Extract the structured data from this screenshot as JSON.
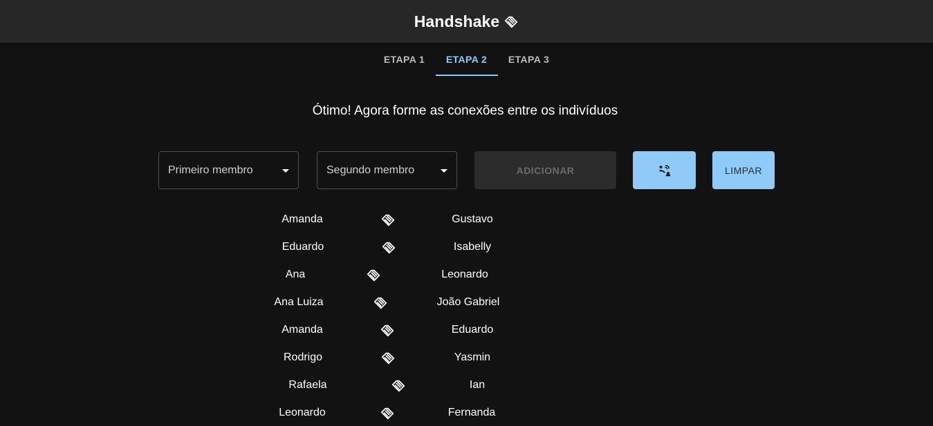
{
  "app": {
    "title": "Handshake",
    "logo_icon": "handshake-icon"
  },
  "tabs": [
    {
      "label": "ETAPA 1",
      "active": false
    },
    {
      "label": "ETAPA 2",
      "active": true
    },
    {
      "label": "ETAPA 3",
      "active": false
    }
  ],
  "instruction": "Ótimo! Agora forme as conexões entre os indivíduos",
  "form": {
    "first_member": {
      "placeholder": "Primeiro membro",
      "icon": "chevron-down-icon"
    },
    "second_member": {
      "placeholder": "Segundo membro",
      "icon": "chevron-down-icon"
    },
    "add_label": "ADICIONAR",
    "add_disabled": true,
    "connect_icon": "connect-icon",
    "clear_label": "LIMPAR"
  },
  "connections": [
    {
      "left": "Amanda",
      "right": "Gustavo"
    },
    {
      "left": "Eduardo",
      "right": "Isabelly"
    },
    {
      "left": "Ana",
      "right": "Leonardo"
    },
    {
      "left": "Ana Luiza",
      "right": "João Gabriel"
    },
    {
      "left": "Amanda",
      "right": "Eduardo"
    },
    {
      "left": "Rodrigo",
      "right": "Yasmin"
    },
    {
      "left": "Rafaela",
      "right": "Ian"
    },
    {
      "left": "Leonardo",
      "right": "Fernanda"
    }
  ],
  "colors": {
    "background": "#121212",
    "appbar": "#272727",
    "accent": "#90caf9",
    "text": "#ffffff"
  }
}
